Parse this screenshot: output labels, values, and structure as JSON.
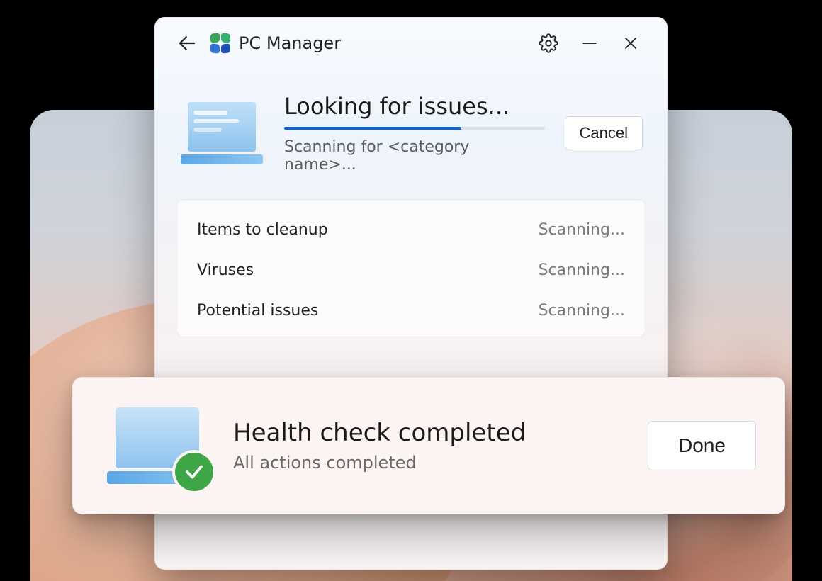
{
  "window": {
    "app_title": "PC Manager"
  },
  "scan": {
    "title": "Looking for issues...",
    "subtitle": "Scanning for <category name>...",
    "progress_percent": 68,
    "cancel_label": "Cancel",
    "categories": [
      {
        "name": "Items to cleanup",
        "status": "Scanning..."
      },
      {
        "name": "Viruses",
        "status": "Scanning..."
      },
      {
        "name": "Potential issues",
        "status": "Scanning..."
      }
    ]
  },
  "banner": {
    "title": "Health check completed",
    "subtitle": "All actions completed",
    "done_label": "Done"
  },
  "colors": {
    "accent": "#0a66d6",
    "success": "#3fa648"
  }
}
